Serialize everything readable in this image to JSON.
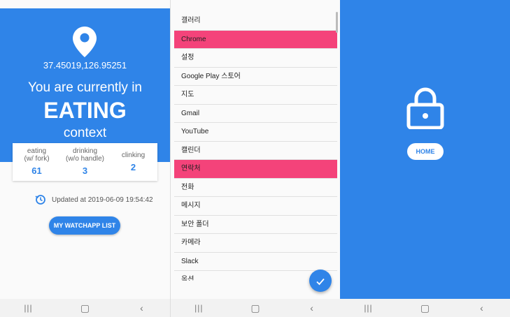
{
  "colors": {
    "accent": "#2f84e8",
    "selected": "#f4437a"
  },
  "panel1": {
    "coordinates": "37.45019,126.95251",
    "line1": "You are currently in",
    "context_name": "EATING",
    "line3": "context",
    "stats": [
      {
        "label": "eating\n(w/ fork)",
        "value": "61"
      },
      {
        "label": "drinking\n(w/o handle)",
        "value": "3"
      },
      {
        "label": "clinking",
        "value": "2"
      }
    ],
    "updated": "Updated at 2019-06-09 19:54:42",
    "button": "MY WATCHAPP LIST"
  },
  "panel2": {
    "apps": [
      {
        "name": "갤러리",
        "selected": false
      },
      {
        "name": "Chrome",
        "selected": true
      },
      {
        "name": "설정",
        "selected": false
      },
      {
        "name": "Google Play 스토어",
        "selected": false
      },
      {
        "name": "지도",
        "selected": false
      },
      {
        "name": "Gmail",
        "selected": false
      },
      {
        "name": "YouTube",
        "selected": false
      },
      {
        "name": "캘린더",
        "selected": false
      },
      {
        "name": "연락처",
        "selected": true
      },
      {
        "name": "전화",
        "selected": false
      },
      {
        "name": "메시지",
        "selected": false
      },
      {
        "name": "보안 폴더",
        "selected": false
      },
      {
        "name": "카메라",
        "selected": false
      },
      {
        "name": "Slack",
        "selected": false
      },
      {
        "name": "옥션",
        "selected": false
      }
    ],
    "fab_icon": "check-icon"
  },
  "panel3": {
    "lock_icon": "lock-icon",
    "button": "HOME"
  },
  "navbar": {
    "recent": "|||",
    "home": "▢",
    "back": "‹"
  }
}
